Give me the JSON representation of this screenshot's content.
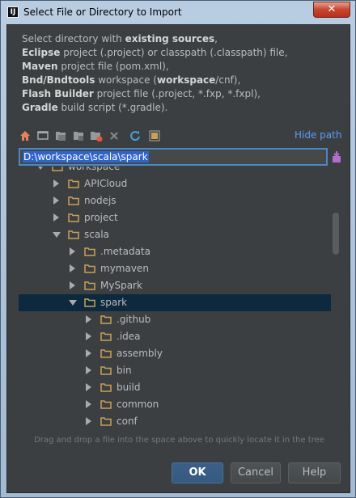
{
  "window": {
    "title": "Select File or Directory to Import",
    "app_icon_text": "IJ",
    "close_label": "✕"
  },
  "description": {
    "line1_pre": "Select directory with ",
    "line1_bold": "existing sources",
    "line1_post": ",",
    "line2_bold": "Eclipse",
    "line2_post": " project (.project) or classpath (.classpath) file,",
    "line3_bold": "Maven",
    "line3_post": " project file (pom.xml),",
    "line4_bold": "Bnd/Bndtools",
    "line4_mid": " workspace (",
    "line4_bold2": "workspace",
    "line4_post": "/cnf),",
    "line5_bold": "Flash Builder",
    "line5_post": " project file (.project, *.fxp, *.fxpl),",
    "line6_bold": "Gradle",
    "line6_post": " build script (*.gradle)."
  },
  "toolbar": {
    "icons": [
      "home-icon",
      "desktop-icon",
      "project-folder-icon",
      "module-folder-icon",
      "new-folder-icon",
      "delete-icon",
      "refresh-icon",
      "show-hidden-icon"
    ],
    "hide_path_label": "Hide path"
  },
  "path": {
    "value": "D:\\workspace\\scala\\spark"
  },
  "tree": {
    "rows": [
      {
        "label": "workspace",
        "state": "expanded",
        "depth": 1
      },
      {
        "label": "APICloud",
        "state": "collapsed",
        "depth": 2
      },
      {
        "label": "nodejs",
        "state": "collapsed",
        "depth": 2
      },
      {
        "label": "project",
        "state": "collapsed",
        "depth": 2
      },
      {
        "label": "scala",
        "state": "expanded",
        "depth": 2
      },
      {
        "label": ".metadata",
        "state": "collapsed",
        "depth": 3
      },
      {
        "label": "mymaven",
        "state": "collapsed",
        "depth": 3
      },
      {
        "label": "MySpark",
        "state": "collapsed",
        "depth": 3
      },
      {
        "label": "spark",
        "state": "expanded",
        "depth": 3,
        "selected": true
      },
      {
        "label": ".github",
        "state": "collapsed",
        "depth": 4
      },
      {
        "label": ".idea",
        "state": "collapsed",
        "depth": 4
      },
      {
        "label": "assembly",
        "state": "collapsed",
        "depth": 4
      },
      {
        "label": "bin",
        "state": "collapsed",
        "depth": 4
      },
      {
        "label": "build",
        "state": "collapsed",
        "depth": 4
      },
      {
        "label": "common",
        "state": "collapsed",
        "depth": 4
      },
      {
        "label": "conf",
        "state": "collapsed",
        "depth": 4
      }
    ]
  },
  "hint": "Drag and drop a file into the space above to quickly locate it in the tree",
  "buttons": {
    "ok": "OK",
    "cancel": "Cancel",
    "help": "Help"
  },
  "colors": {
    "background": "#3c3f41",
    "selection": "#0d293e",
    "link": "#589df6",
    "folder": "#c9a155"
  }
}
